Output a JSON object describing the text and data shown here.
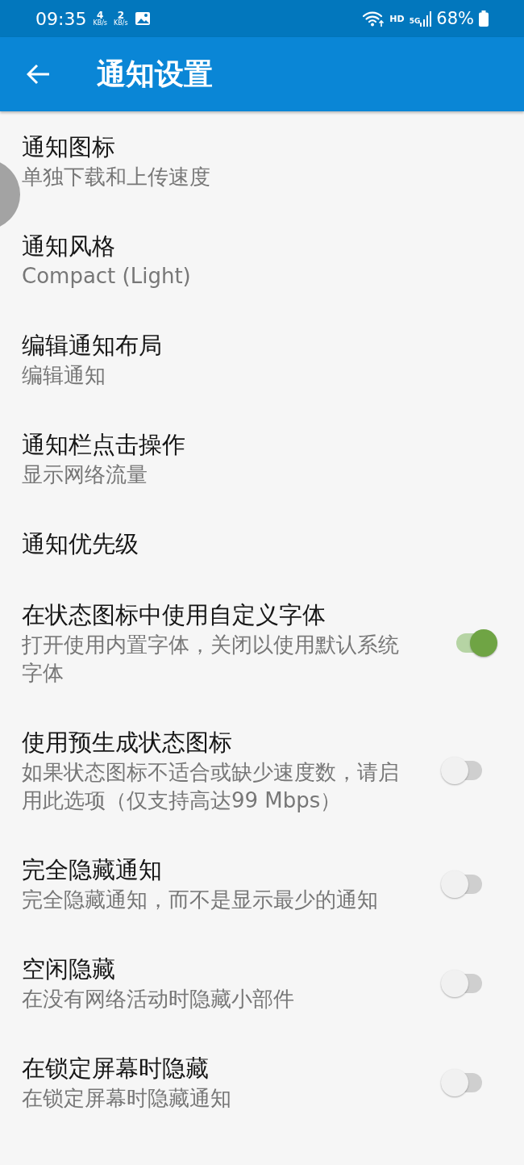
{
  "status_bar": {
    "time": "09:35",
    "download_speed": "4",
    "download_unit": "KB/s",
    "upload_speed": "2",
    "upload_unit": "KB/s",
    "hd_label": "HD",
    "network_label": "5G",
    "battery": "68%"
  },
  "app_bar": {
    "title": "通知设置"
  },
  "settings": [
    {
      "kind": "plain",
      "title": "通知图标",
      "subtitle": "单独下载和上传速度"
    },
    {
      "kind": "plain",
      "title": "通知风格",
      "subtitle": "Compact (Light)"
    },
    {
      "kind": "plain",
      "title": "编辑通知布局",
      "subtitle": "编辑通知"
    },
    {
      "kind": "plain",
      "title": "通知栏点击操作",
      "subtitle": "显示网络流量"
    },
    {
      "kind": "plain",
      "title": "通知优先级"
    },
    {
      "kind": "toggle",
      "title": "在状态图标中使用自定义字体",
      "subtitle": "打开使用内置字体，关闭以使用默认系统字体",
      "on": true
    },
    {
      "kind": "toggle",
      "title": "使用预生成状态图标",
      "subtitle": "如果状态图标不适合或缺少速度数，请启用此选项（仅支持高达99 Mbps）",
      "on": false
    },
    {
      "kind": "toggle",
      "title": "完全隐藏通知",
      "subtitle": "完全隐藏通知，而不是显示最少的通知",
      "on": false
    },
    {
      "kind": "toggle",
      "title": "空闲隐藏",
      "subtitle": "在没有网络活动时隐藏小部件",
      "on": false
    },
    {
      "kind": "toggle",
      "title": "在锁定屏幕时隐藏",
      "subtitle": "在锁定屏幕时隐藏通知",
      "on": false
    }
  ]
}
